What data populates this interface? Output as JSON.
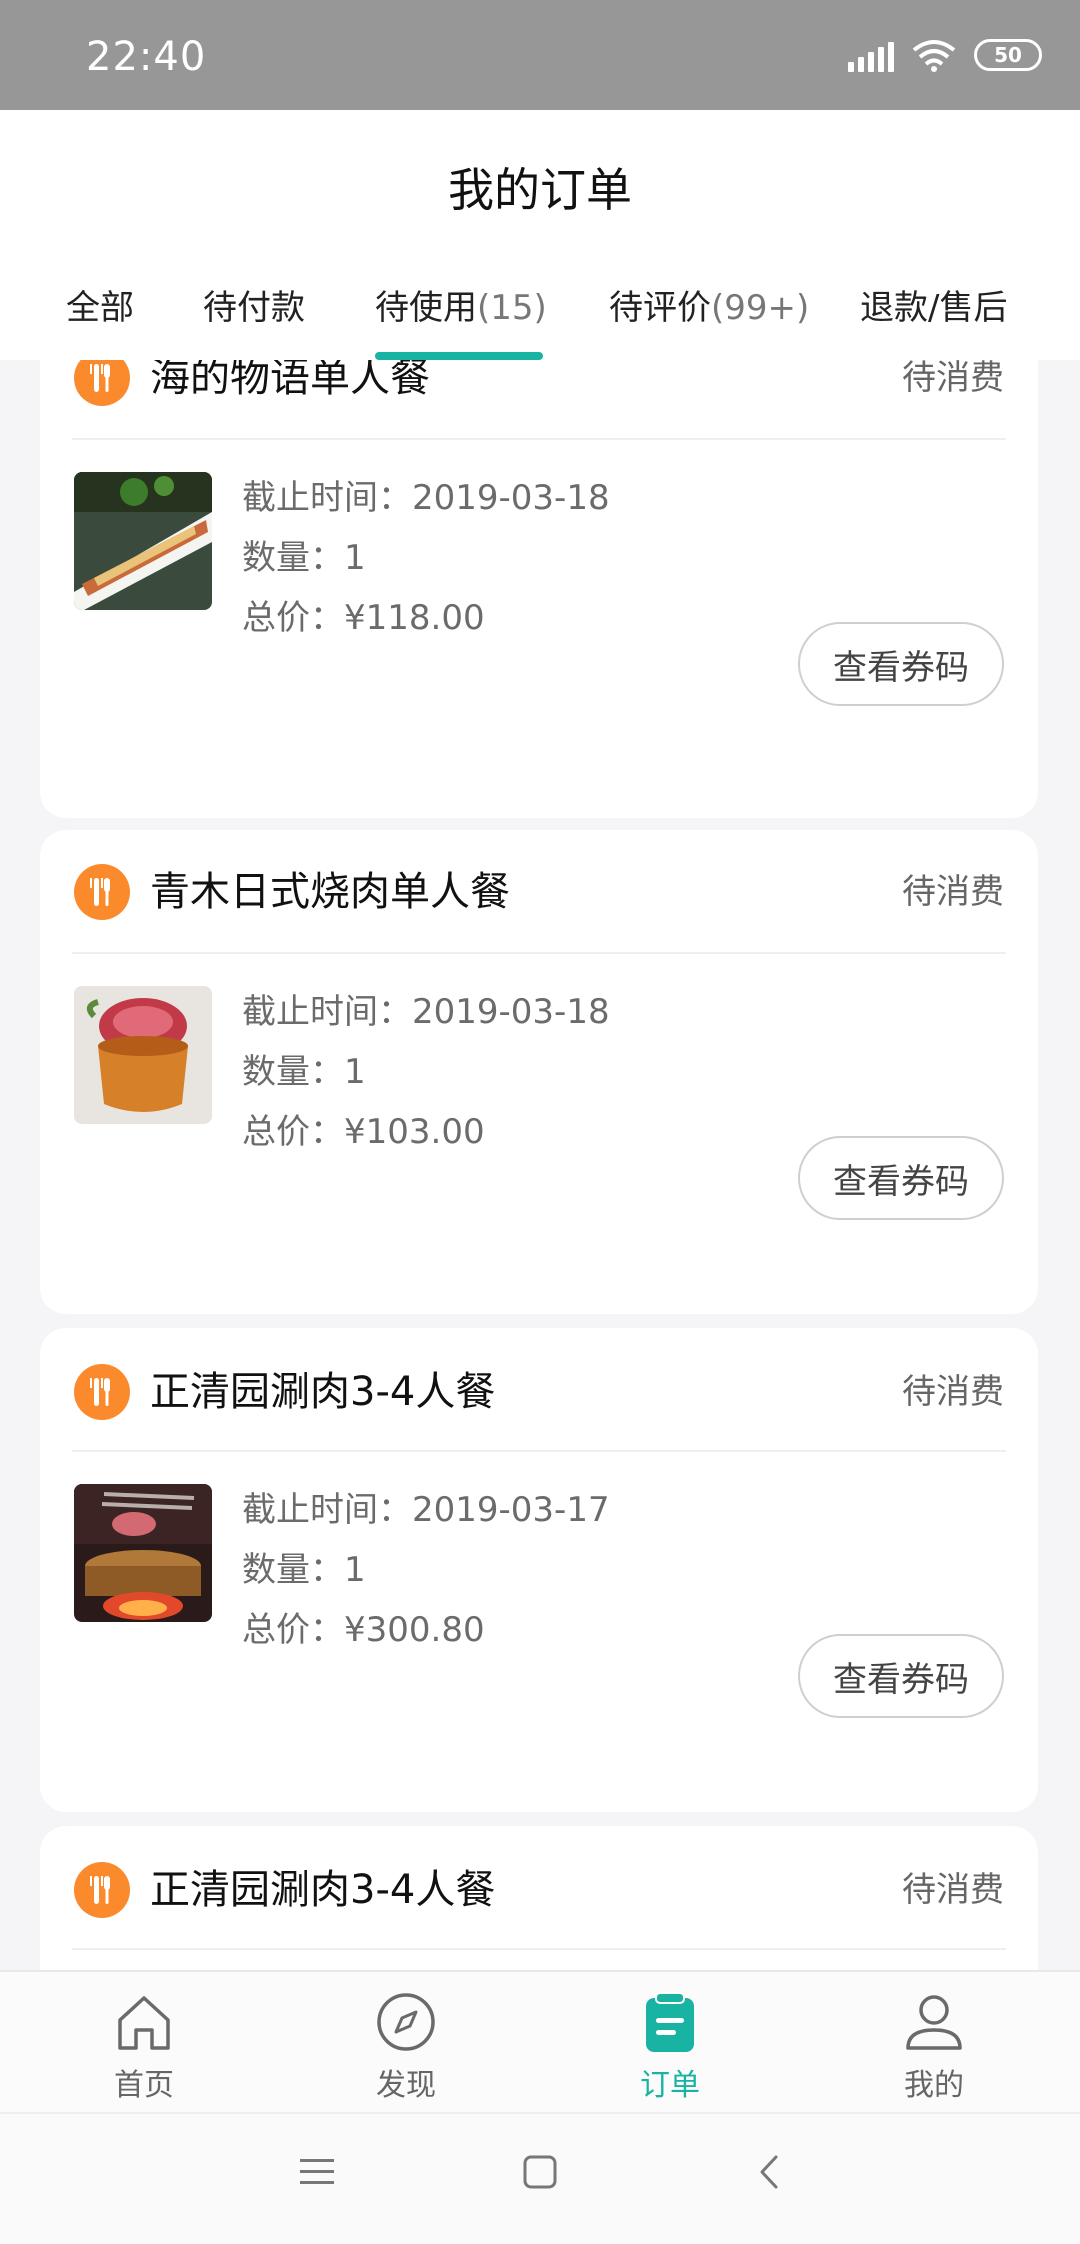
{
  "status_bar": {
    "time": "22:40",
    "battery": "50"
  },
  "header": {
    "title": "我的订单",
    "tabs": [
      {
        "label": "全部",
        "count": ""
      },
      {
        "label": "待付款",
        "count": ""
      },
      {
        "label": "待使用",
        "count": "(15)"
      },
      {
        "label": "待评价",
        "count": "(99+)"
      },
      {
        "label": "退款/售后",
        "count": ""
      }
    ],
    "active_tab": 2
  },
  "orders": [
    {
      "shop": "海的物语单人餐",
      "status": "待消费",
      "deadline": "截止时间：2019-03-18",
      "quantity": "数量：1",
      "total": "总价：¥118.00",
      "button": "查看券码"
    },
    {
      "shop": "青木日式烧肉单人餐",
      "status": "待消费",
      "deadline": "截止时间：2019-03-18",
      "quantity": "数量：1",
      "total": "总价：¥103.00",
      "button": "查看券码"
    },
    {
      "shop": "正清园涮肉3-4人餐",
      "status": "待消费",
      "deadline": "截止时间：2019-03-17",
      "quantity": "数量：1",
      "total": "总价：¥300.80",
      "button": "查看券码"
    },
    {
      "shop": "正清园涮肉3-4人餐",
      "status": "待消费",
      "deadline": "",
      "quantity": "",
      "total": "",
      "button": ""
    }
  ],
  "bottom_nav": [
    {
      "label": "首页",
      "icon": "home-icon"
    },
    {
      "label": "发现",
      "icon": "compass-icon"
    },
    {
      "label": "订单",
      "icon": "clipboard-icon"
    },
    {
      "label": "我的",
      "icon": "user-icon"
    }
  ],
  "colors": {
    "accent": "#19b3a3",
    "shop_icon": "#fb8a2d"
  }
}
